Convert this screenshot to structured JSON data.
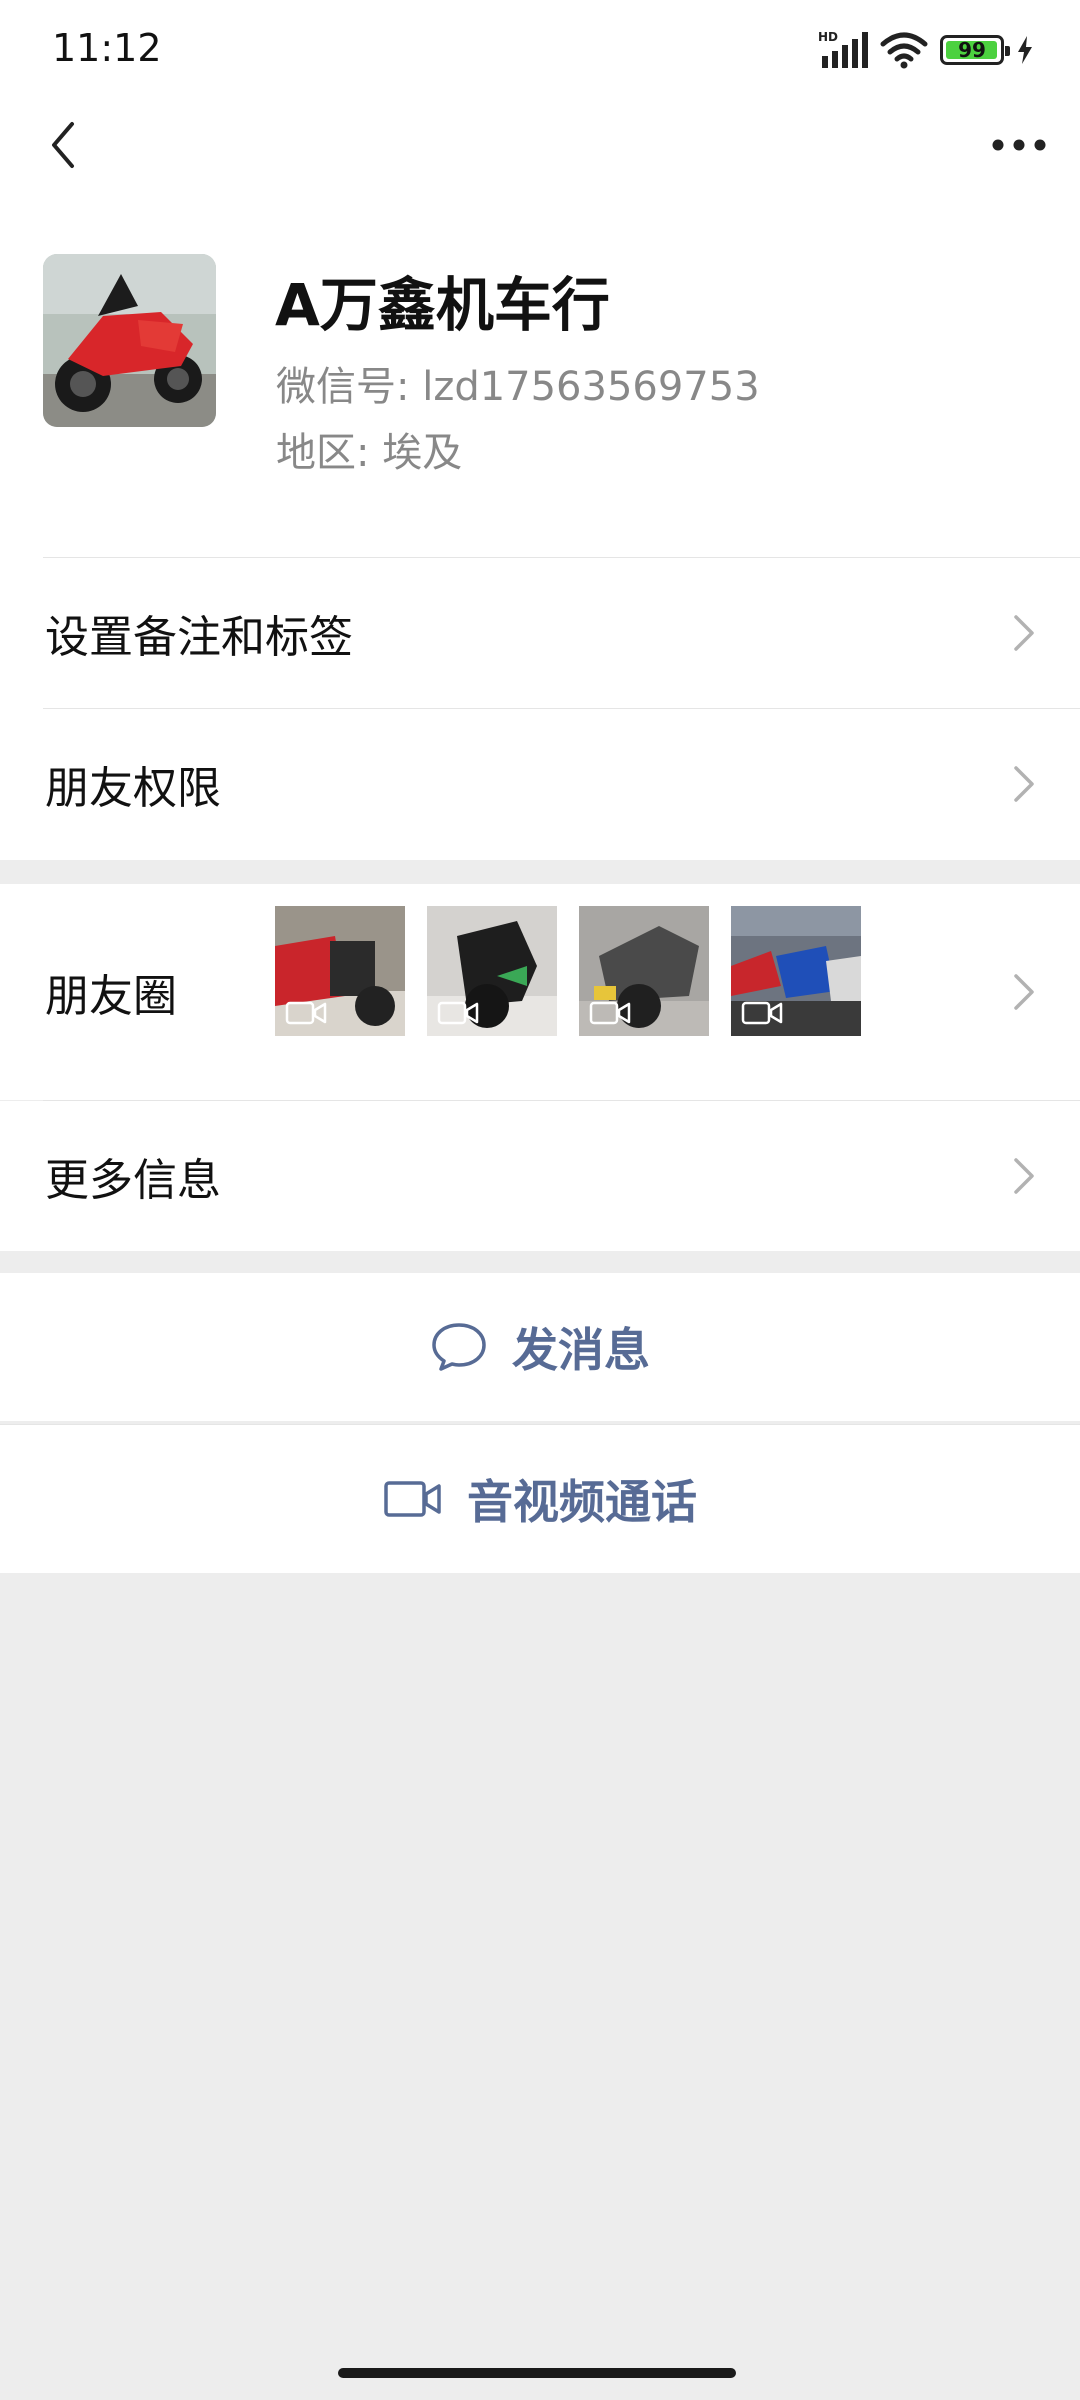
{
  "status_bar": {
    "time": "11:12",
    "network_label": "HD",
    "battery_level": 0.99,
    "battery_text": "99",
    "battery_color": "#4cd13f",
    "icons": [
      "signal-icon",
      "wifi-icon",
      "battery-icon",
      "charging-icon"
    ]
  },
  "nav": {
    "back_icon": "chevron-left-icon",
    "more_icon": "more-icon"
  },
  "profile": {
    "name": "A万鑫机车行",
    "wechat_id_label": "微信号:",
    "wechat_id": "lzd17563569753",
    "region_label": "地区:",
    "region": "埃及"
  },
  "menu": {
    "remark_tags": "设置备注和标签",
    "friend_permissions": "朋友权限",
    "moments": "朋友圈",
    "more_info": "更多信息"
  },
  "moments_thumbnails": [
    {
      "type": "video",
      "subject": "red motorcycle"
    },
    {
      "type": "video",
      "subject": "black motorcycle"
    },
    {
      "type": "video",
      "subject": "grey motorcycle"
    },
    {
      "type": "video",
      "subject": "motorcycle showroom"
    }
  ],
  "actions": {
    "send_message": "发消息",
    "av_call": "音视频通话"
  },
  "colors": {
    "link": "#576b95",
    "background": "#ededed",
    "surface": "#ffffff"
  }
}
